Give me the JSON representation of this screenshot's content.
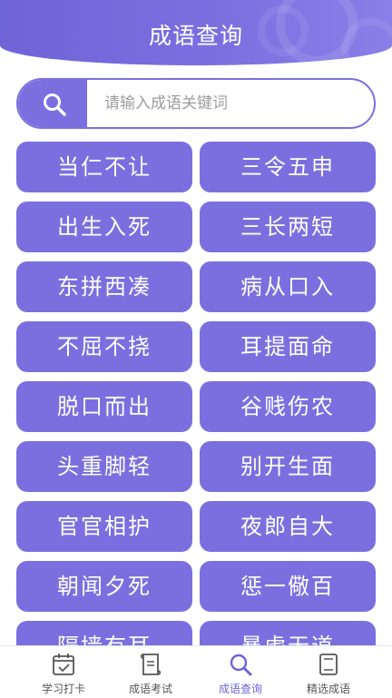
{
  "header": {
    "title": "成语查询"
  },
  "search": {
    "placeholder": "请输入成语关键词"
  },
  "idioms": [
    "当仁不让",
    "三令五申",
    "出生入死",
    "三长两短",
    "东拼西凑",
    "病从口入",
    "不屈不挠",
    "耳提面命",
    "脱口而出",
    "谷贱伤农",
    "头重脚轻",
    "别开生面",
    "官官相护",
    "夜郎自大",
    "朝闻夕死",
    "惩一儆百",
    "隔墙有耳",
    "暴虎无道"
  ],
  "tabs": [
    {
      "label": "学习打卡",
      "icon": "calendar-check-icon"
    },
    {
      "label": "成语考试",
      "icon": "exam-scroll-icon"
    },
    {
      "label": "成语查询",
      "icon": "search-icon"
    },
    {
      "label": "精选成语",
      "icon": "book-icon"
    }
  ],
  "active_tab": 2,
  "colors": {
    "accent": "#7b6fe0",
    "text_inactive": "#555555"
  }
}
